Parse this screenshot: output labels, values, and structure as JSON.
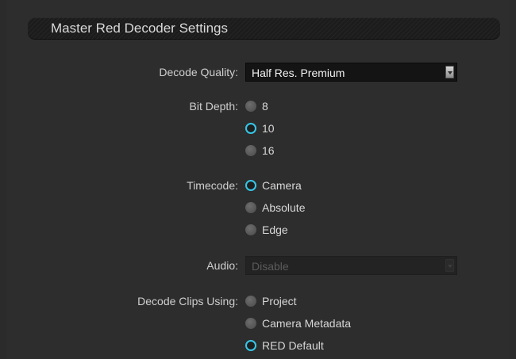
{
  "section": {
    "title": "Master Red Decoder Settings"
  },
  "decode_quality": {
    "label": "Decode Quality:",
    "value": "Half Res. Premium"
  },
  "bit_depth": {
    "label": "Bit Depth:",
    "options": [
      {
        "label": "8",
        "checked": false
      },
      {
        "label": "10",
        "checked": true
      },
      {
        "label": "16",
        "checked": false
      }
    ]
  },
  "timecode": {
    "label": "Timecode:",
    "options": [
      {
        "label": "Camera",
        "checked": true
      },
      {
        "label": "Absolute",
        "checked": false
      },
      {
        "label": "Edge",
        "checked": false
      }
    ]
  },
  "audio": {
    "label": "Audio:",
    "value": "Disable",
    "disabled": true
  },
  "decode_clips_using": {
    "label": "Decode Clips Using:",
    "options": [
      {
        "label": "Project",
        "checked": false
      },
      {
        "label": "Camera Metadata",
        "checked": false
      },
      {
        "label": "RED Default",
        "checked": true
      }
    ]
  },
  "colors": {
    "accent": "#36c7e8",
    "background": "#2d2d2d",
    "header": "#1c1c1c"
  }
}
